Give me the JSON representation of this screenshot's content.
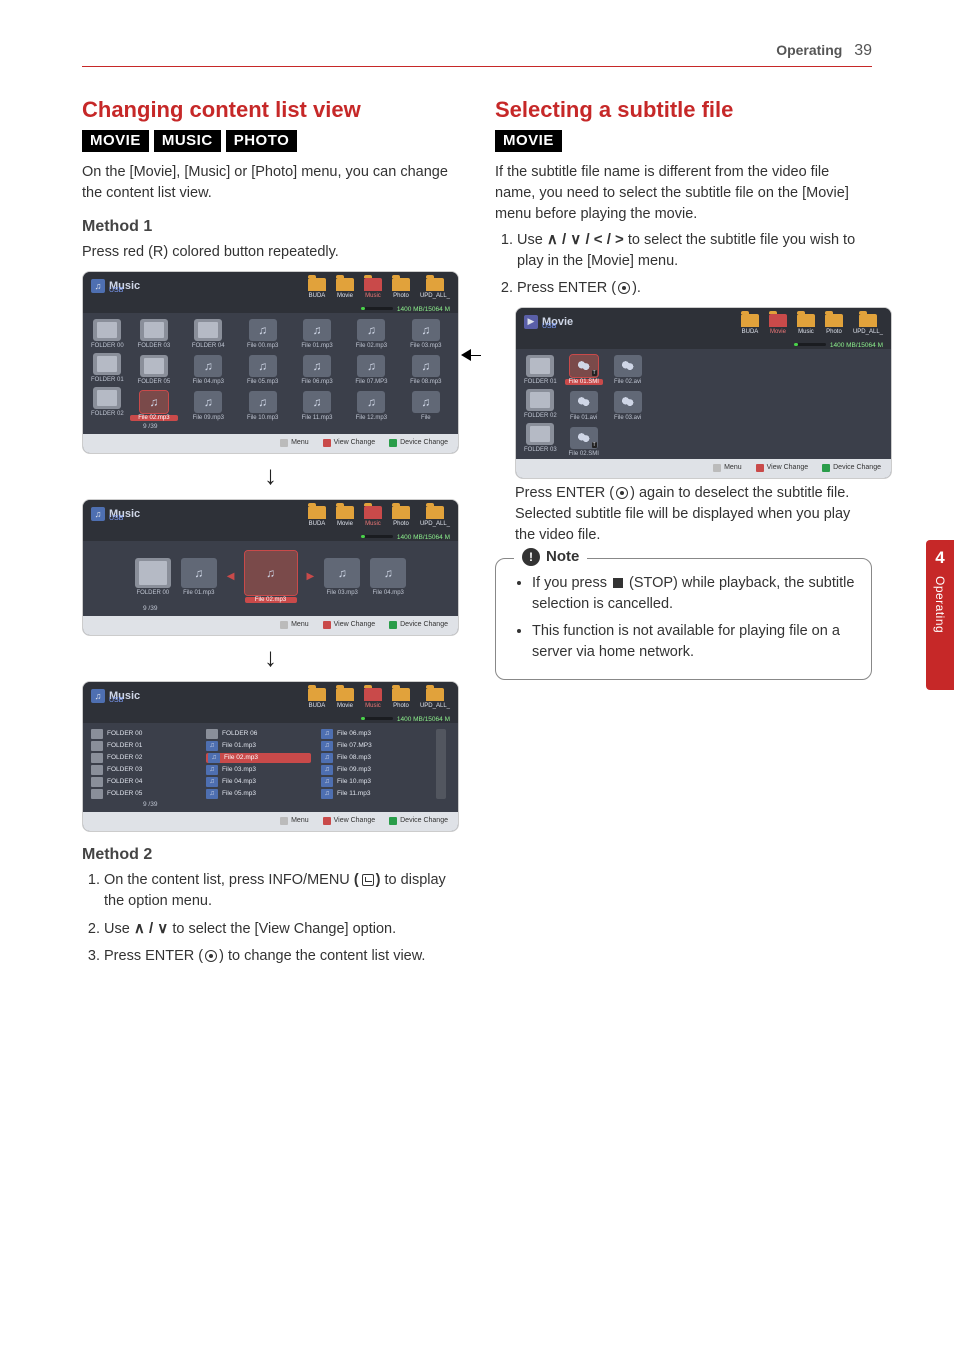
{
  "header": {
    "section": "Operating",
    "page_number": "39"
  },
  "side_tab": {
    "number": "4",
    "label": "Operating"
  },
  "left": {
    "heading": "Changing content list view",
    "labels": [
      "MOVIE",
      "MUSIC",
      "PHOTO"
    ],
    "intro": "On the [Movie], [Music] or [Photo] menu, you can change the content list view.",
    "method1_title": "Method 1",
    "method1_text": "Press red (R) colored button repeatedly.",
    "method2_title": "Method 2",
    "method2_steps": [
      "On the content list, press INFO/MENU",
      "to display the option menu.",
      "to select the [View Change] option.",
      "Press ENTER (",
      ") to change the content list view."
    ],
    "method2_step2_prefix": "Use ",
    "arrows_2": "∧ / ∨",
    "mock_common": {
      "music_title": "Music",
      "movie_title": "Movie",
      "source": "USB",
      "tabs": [
        "BUDA",
        "Movie",
        "Music",
        "Photo",
        "UPD_ALL_"
      ],
      "usage": "1400 MB/15064 M",
      "footer": {
        "menu": "Menu",
        "view_change": "View Change",
        "device_change": "Device Change"
      },
      "counter": "9 /39"
    },
    "mock1": {
      "folders": [
        "FOLDER 00",
        "FOLDER 01",
        "FOLDER 02"
      ],
      "row1": [
        "FOLDER 03",
        "FOLDER 04",
        "File 00.mp3",
        "File 01.mp3",
        "File 02.mp3",
        "File 03.mp3"
      ],
      "row2": [
        "FOLDER 05",
        "File 04.mp3",
        "File 05.mp3",
        "File 06.mp3",
        "File 07.MP3",
        "File 08.mp3"
      ],
      "row3": [
        "File 02.mp3",
        "File 09.mp3",
        "File 10.mp3",
        "File 11.mp3",
        "File 12.mp3",
        "File"
      ],
      "selected": "File 02.mp3"
    },
    "mock2": {
      "folder": "FOLDER 00",
      "items": [
        "File 01.mp3",
        "File 02.mp3",
        "File 03.mp3",
        "File 04.mp3"
      ],
      "selected": "File 02.mp3"
    },
    "mock3": {
      "colA": [
        "FOLDER 00",
        "FOLDER 01",
        "FOLDER 02",
        "FOLDER 03",
        "FOLDER 04",
        "FOLDER 05"
      ],
      "colB": [
        "FOLDER 06",
        "File 01.mp3",
        "File 02.mp3",
        "File 03.mp3",
        "File 04.mp3",
        "File 05.mp3"
      ],
      "colC": [
        "File 06.mp3",
        "File 07.MP3",
        "File 08.mp3",
        "File 09.mp3",
        "File 10.mp3",
        "File 11.mp3"
      ],
      "selected": "File 02.mp3"
    }
  },
  "right": {
    "heading": "Selecting a subtitle file",
    "labels": [
      "MOVIE"
    ],
    "intro": "If the subtitle file name is different from the video file name, you need to select the subtitle file on the [Movie] menu before playing the movie.",
    "step1_pre": "Use ",
    "arrows_4": "∧ / ∨ / < / >",
    "step1_post": " to select the subtitle file you wish to play in the [Movie] menu.",
    "step2_pre": "Press ENTER (",
    "step2_post": ").",
    "after_img": "Press ENTER (",
    "after_img2": ") again to deselect the subtitle file. Selected subtitle file will be displayed when you play the video file.",
    "note_title": "Note",
    "note_items": [
      "If you press ",
      " (STOP) while playback, the subtitle selection is cancelled.",
      "This function is not available for playing file on a server via home network."
    ],
    "mock": {
      "folders": [
        "FOLDER 01",
        "FOLDER 02",
        "FOLDER 03"
      ],
      "files_r1": [
        "File 01.SMI",
        "File 02.avi"
      ],
      "files_r2": [
        "File 01.avi",
        "File 03.avi"
      ],
      "files_r3": [
        "File 02.SMI"
      ],
      "selected": "File 01.SMI"
    }
  }
}
